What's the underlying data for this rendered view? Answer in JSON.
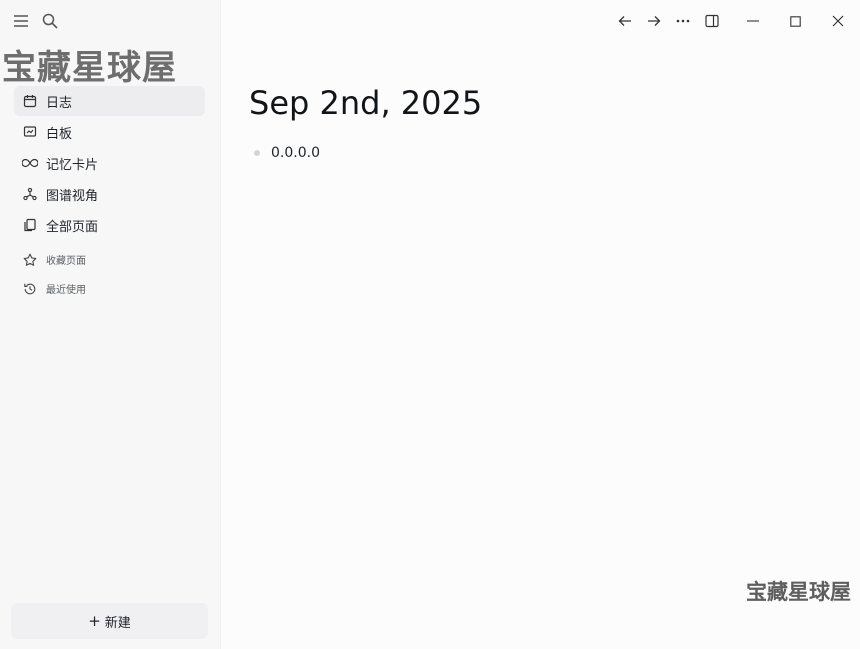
{
  "watermark": {
    "top": "宝藏星球屋",
    "bottom": "宝藏星球屋"
  },
  "sidebar": {
    "nav_items": [
      {
        "label": "日志",
        "icon": "calendar-icon",
        "active": true
      },
      {
        "label": "白板",
        "icon": "whiteboard-icon"
      },
      {
        "label": "记忆卡片",
        "icon": "infinity-icon"
      },
      {
        "label": "图谱视角",
        "icon": "graph-icon"
      },
      {
        "label": "全部页面",
        "icon": "pages-icon"
      }
    ],
    "sub_items": [
      {
        "label": "收藏页面",
        "icon": "star-icon"
      },
      {
        "label": "最近使用",
        "icon": "history-icon"
      }
    ],
    "new_button": {
      "plus": "+",
      "label": "新建"
    }
  },
  "main": {
    "title": "Sep 2nd, 2025",
    "blocks": [
      {
        "text": "0.0.0.0"
      }
    ]
  },
  "colors": {
    "accent": "#1f2329",
    "sidebar_bg": "#f7f7f8",
    "active_bg": "#ededef"
  }
}
